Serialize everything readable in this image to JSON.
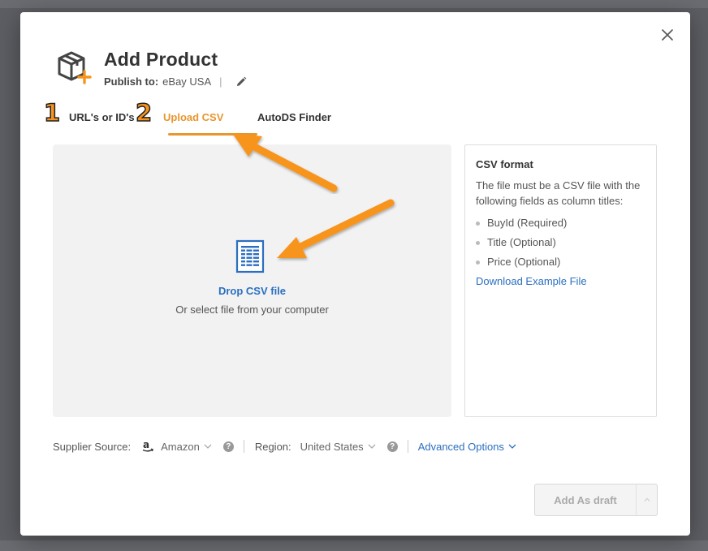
{
  "modal": {
    "title": "Add Product",
    "publish_label": "Publish to:",
    "publish_value": "eBay USA",
    "publish_sep": "|",
    "close_icon": "close-icon",
    "edit_icon": "pencil-icon",
    "product_icon": "box-plus-icon"
  },
  "steps": {
    "one": "1",
    "two": "2"
  },
  "tabs": [
    {
      "label": "URL's or ID's",
      "active": false
    },
    {
      "label": "Upload CSV",
      "active": true
    },
    {
      "label": "AutoDS Finder",
      "active": false
    }
  ],
  "drop_zone": {
    "title": "Drop CSV file",
    "subtitle": "Or select file from your computer",
    "icon": "csv-file-icon"
  },
  "csv_format": {
    "title": "CSV format",
    "description": "The file must be a CSV file with the following fields as column titles:",
    "fields": [
      "BuyId (Required)",
      "Title (Optional)",
      "Price (Optional)"
    ],
    "download_link": "Download Example File"
  },
  "supplier": {
    "label": "Supplier Source:",
    "value": "Amazon",
    "icon": "amazon-icon"
  },
  "region": {
    "label": "Region:",
    "value": "United States"
  },
  "advanced_options": "Advanced Options",
  "actions": {
    "add_draft": "Add As draft"
  },
  "colors": {
    "accent": "#e8962e",
    "link": "#2a6fc0",
    "annotation_arrow": "#f7941d"
  }
}
